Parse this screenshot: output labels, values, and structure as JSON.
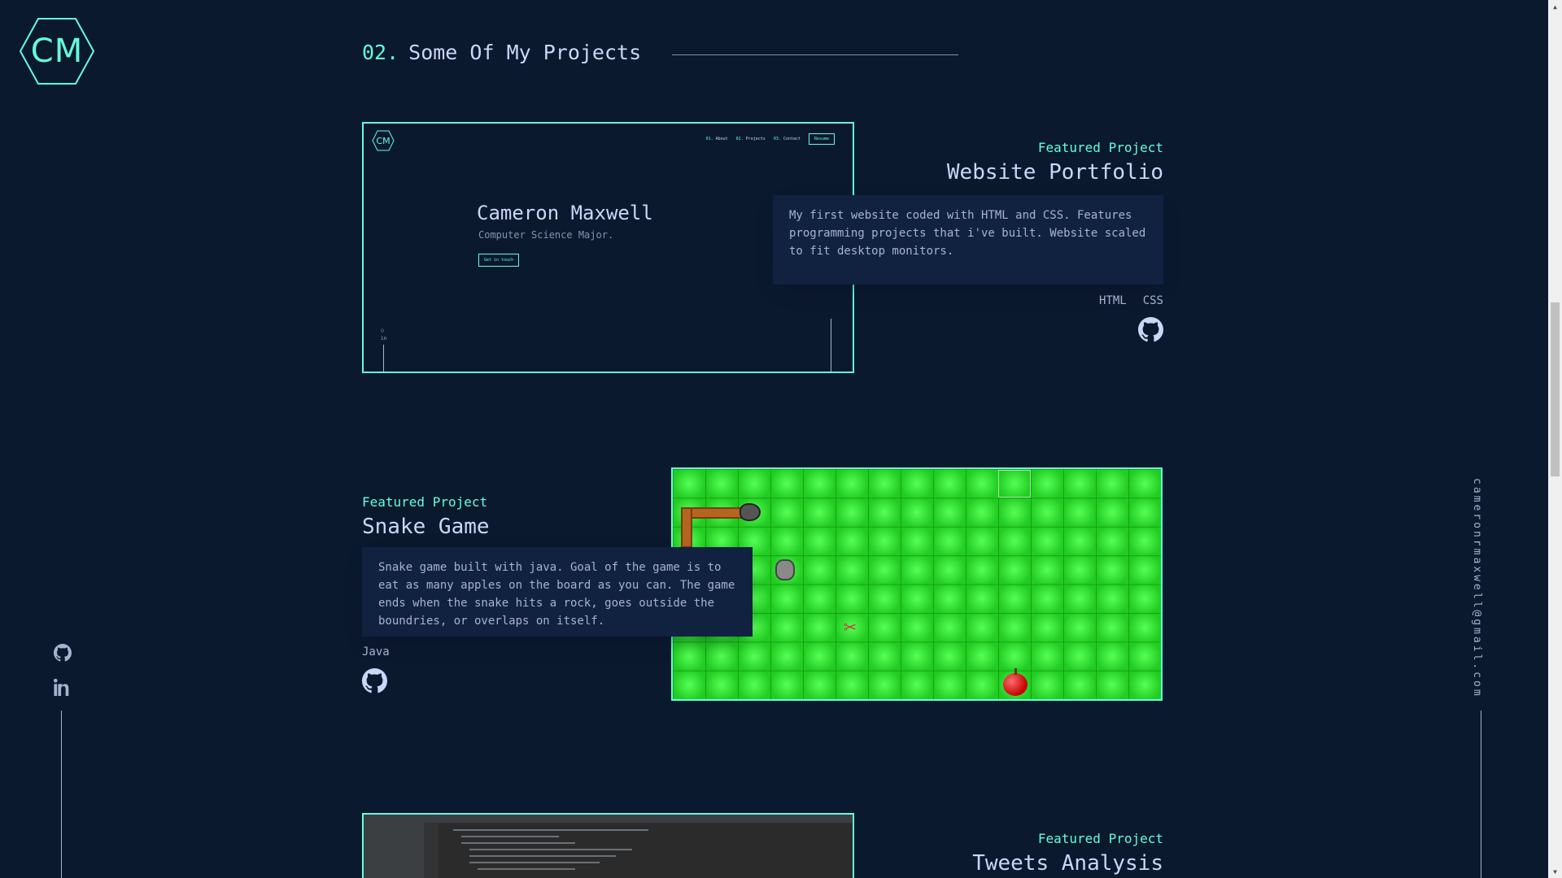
{
  "logo": {
    "text": "CM"
  },
  "section": {
    "number": "02.",
    "title": "Some Of My Projects"
  },
  "email": "cameronrmaxwell@gmail.com",
  "colors": {
    "background": "#0b192f",
    "accent": "#64ffda",
    "panel": "#112240",
    "text": "#ccd6f6"
  },
  "left_social": [
    {
      "icon": "github-icon"
    },
    {
      "icon": "linkedin-icon"
    }
  ],
  "projects": [
    {
      "overline": "Featured Project",
      "title": "Website Portfolio",
      "description": "My first website coded with HTML and CSS. Features programming projects that i've built. Website scaled to fit desktop monitors.",
      "tech": [
        "HTML",
        "CSS"
      ],
      "screenshot": {
        "logo": "CM",
        "nav": [
          {
            "num": "01.",
            "label": "About"
          },
          {
            "num": "02.",
            "label": "Projects"
          },
          {
            "num": "03.",
            "label": "Contact"
          }
        ],
        "resume": "Resume",
        "name": "Cameron Maxwell",
        "subtitle": "Computer Science Major.",
        "button": "Get in touch"
      }
    },
    {
      "overline": "Featured Project",
      "title": "Snake Game",
      "description": "Snake game built with java. Goal of the game is to eat as many apples on the board as you can. The game ends when the snake hits a rock, goes outside the boundries, or overlaps on itself.",
      "tech": [
        "Java"
      ]
    },
    {
      "overline": "Featured Project",
      "title": "Tweets Analysis"
    }
  ]
}
